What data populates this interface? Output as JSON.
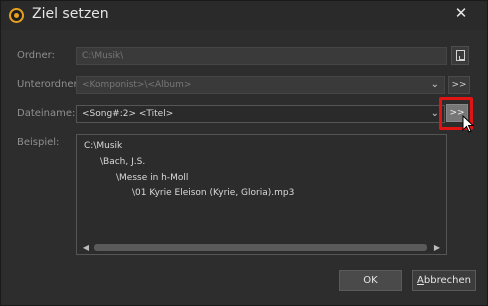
{
  "window": {
    "title": "Ziel setzen",
    "close_glyph": "✕"
  },
  "fields": {
    "ordner": {
      "label": "Ordner:",
      "value": "C:\\Musik\\"
    },
    "unterordner": {
      "label": "Unterordner:",
      "value": "<Komponist>\\<Album>",
      "button": ">>"
    },
    "dateiname": {
      "label": "Dateiname:",
      "value": "<Song#:2> <Titel>",
      "button": ">>"
    },
    "beispiel": {
      "label": "Beispiel:"
    }
  },
  "example": {
    "lines": [
      "C:\\Musik",
      "\\Bach, J.S.",
      "\\Messe in h-Moll",
      "\\01 Kyrie Eleison (Kyrie, Gloria).mp3"
    ]
  },
  "buttons": {
    "ok": "OK",
    "cancel": "Abbrechen"
  },
  "icons": {
    "app": "app-logo-icon",
    "close": "close-icon",
    "browse": "document-icon",
    "dropdown": "chevron-down-icon",
    "cursor": "mouse-cursor-icon"
  },
  "colors": {
    "accent": "#e8a020",
    "highlight": "#e11414"
  }
}
